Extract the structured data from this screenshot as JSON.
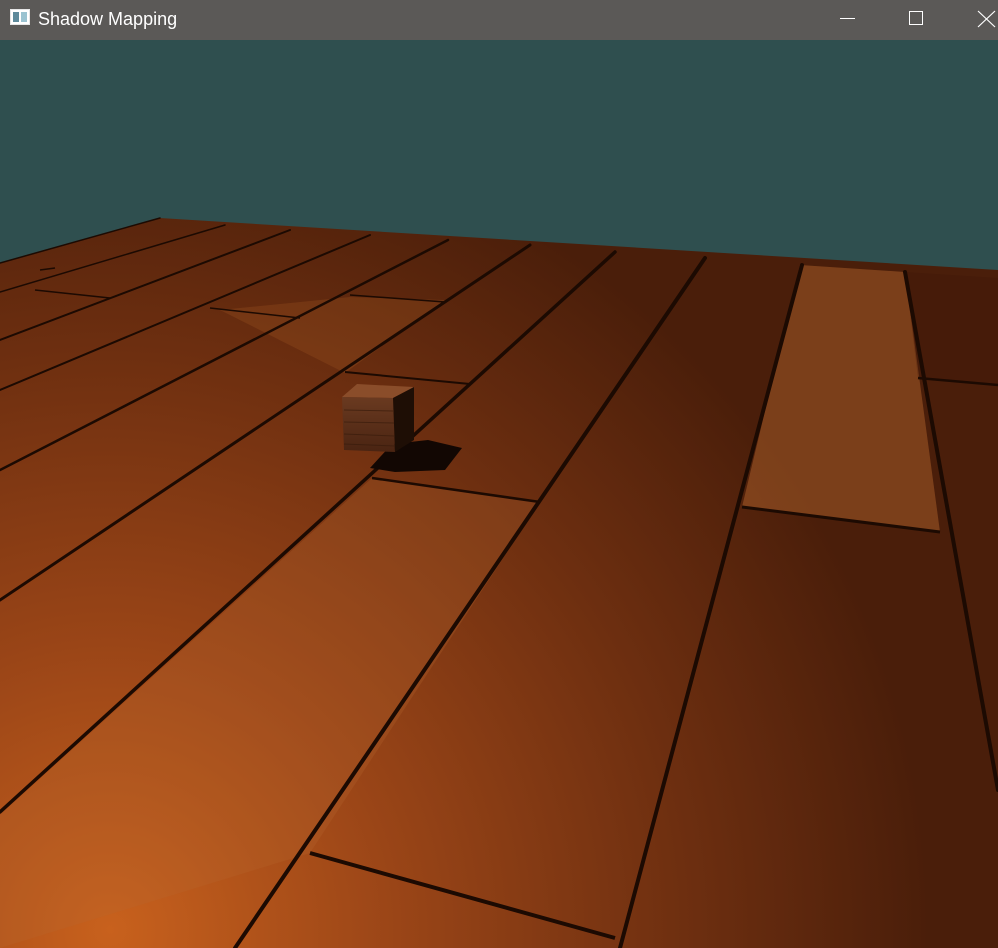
{
  "window": {
    "title": "Shadow Mapping",
    "icon": "opengl-app-window-icon",
    "controls": {
      "minimize_icon": "minimize-icon",
      "maximize_icon": "maximize-icon",
      "close_icon": "close-icon"
    }
  },
  "scene": {
    "clear_color": "#2f4f4f",
    "floor_texture": "wood-planks",
    "floor_color": "#8a3e14",
    "plank_seam_color": "#1a0a02",
    "objects": [
      "wooden-cube"
    ],
    "shadow_color": "#120703"
  },
  "colors": {
    "titlebar_bg": "#5b5957",
    "titlebar_text": "#ffffff"
  }
}
